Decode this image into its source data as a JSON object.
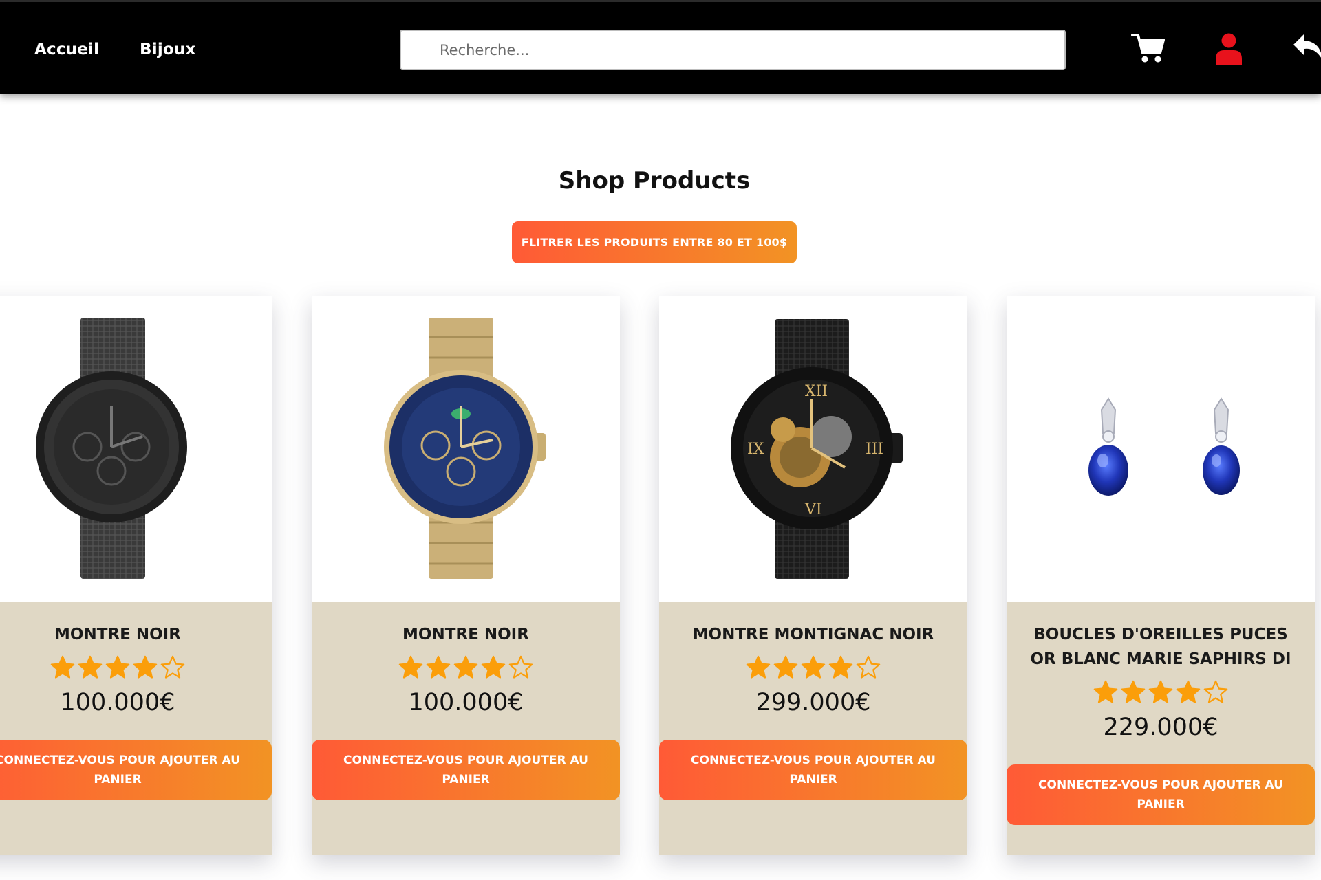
{
  "nav": {
    "home": "Accueil",
    "bijoux": "Bijoux"
  },
  "search": {
    "placeholder": "Recherche..."
  },
  "header_icons": [
    "cart-icon",
    "user-icon",
    "back-arrow-icon"
  ],
  "colors": {
    "header_bg": "#000000",
    "accent_start": "#ff5a36",
    "accent_end": "#f29324",
    "card_bg": "#e0d8c5",
    "star": "#fb9e0a",
    "user_icon": "#e8121c"
  },
  "page": {
    "title": "Shop Products",
    "filter_button": "FLITRER LES PRODUITS ENTRE 80 ET 100$"
  },
  "products": [
    {
      "name": "MONTRE NOIR",
      "price": "100.000€",
      "rating": 4,
      "max_rating": 5,
      "button": "CONNECTEZ-VOUS POUR AJOUTER AU PANIER",
      "image": "black-mesh-watch"
    },
    {
      "name": "MONTRE NOIR",
      "price": "100.000€",
      "rating": 4,
      "max_rating": 5,
      "button": "CONNECTEZ-VOUS POUR AJOUTER AU PANIER",
      "image": "gold-blue-watch"
    },
    {
      "name": "MONTRE MONTIGNAC NOIR",
      "price": "299.000€",
      "rating": 4,
      "max_rating": 5,
      "button": "CONNECTEZ-VOUS POUR AJOUTER AU PANIER",
      "image": "skeleton-watch"
    },
    {
      "name": "BOUCLES D'OREILLES PUCES OR BLANC MARIE SAPHIRS DI",
      "price": "229.000€",
      "rating": 4,
      "max_rating": 5,
      "button": "CONNECTEZ-VOUS POUR AJOUTER AU PANIER",
      "image": "sapphire-earrings"
    }
  ]
}
